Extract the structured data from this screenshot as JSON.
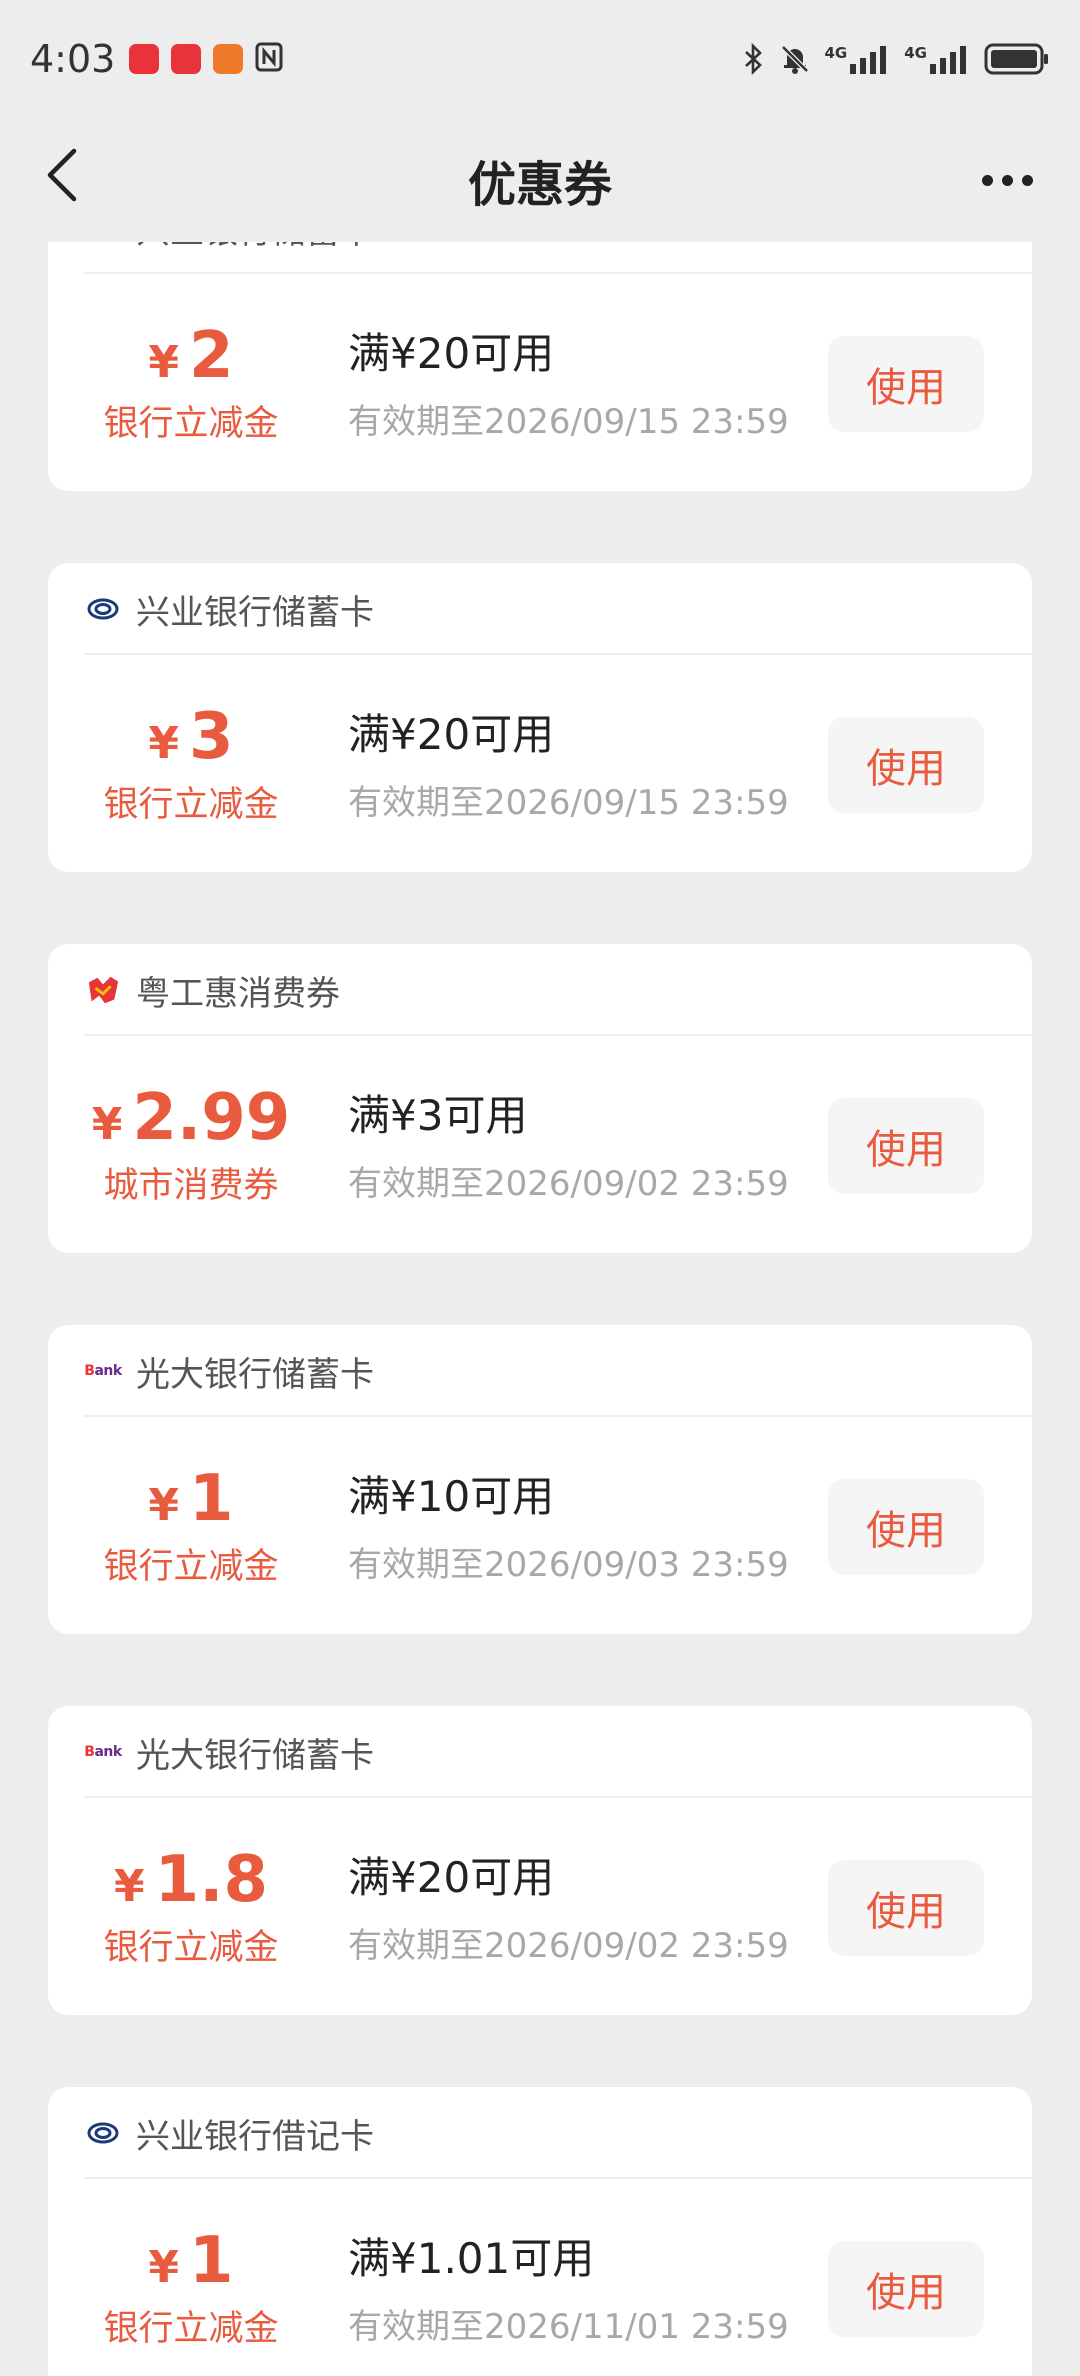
{
  "status_bar": {
    "time": "4:03",
    "network_1": "4G",
    "network_2": "4G",
    "app_icons": [
      "huawei-app-icon",
      "huawei-app-icon",
      "orange-app-icon",
      "nfc-icon"
    ],
    "colors": {
      "app_red": "#e8333a",
      "app_orange": "#f07a2a"
    }
  },
  "header": {
    "title": "优惠券",
    "back_icon": "chevron-left-icon",
    "more_icon": "more-dots-icon"
  },
  "colors": {
    "accent": "#e85b3f",
    "background": "#ededed",
    "card": "#ffffff",
    "button_bg": "#f5f5f5"
  },
  "coupons": [
    {
      "issuer": "兴业银行储蓄卡",
      "logo": "cib-logo",
      "yen": "¥",
      "value": "2",
      "type": "银行立减金",
      "condition": "满¥20可用",
      "validity": "有效期至2026/09/15 23:59",
      "button": "使用"
    },
    {
      "issuer": "兴业银行储蓄卡",
      "logo": "cib-logo",
      "yen": "¥",
      "value": "3",
      "type": "银行立减金",
      "condition": "满¥20可用",
      "validity": "有效期至2026/09/15 23:59",
      "button": "使用"
    },
    {
      "issuer": "粤工惠消费券",
      "logo": "yuegonghui-logo",
      "yen": "¥",
      "value": "2.99",
      "type": "城市消费券",
      "condition": "满¥3可用",
      "validity": "有效期至2026/09/02 23:59",
      "button": "使用"
    },
    {
      "issuer": "光大银行储蓄卡",
      "logo": "bank-logo",
      "logo_text": "Bank",
      "yen": "¥",
      "value": "1",
      "type": "银行立减金",
      "condition": "满¥10可用",
      "validity": "有效期至2026/09/03 23:59",
      "button": "使用"
    },
    {
      "issuer": "光大银行储蓄卡",
      "logo": "bank-logo",
      "logo_text": "Bank",
      "yen": "¥",
      "value": "1.8",
      "type": "银行立减金",
      "condition": "满¥20可用",
      "validity": "有效期至2026/09/02 23:59",
      "button": "使用"
    },
    {
      "issuer": "兴业银行借记卡",
      "logo": "cib-logo",
      "yen": "¥",
      "value": "1",
      "type": "银行立减金",
      "condition": "满¥1.01可用",
      "validity": "有效期至2026/11/01 23:59",
      "button": "使用"
    }
  ]
}
